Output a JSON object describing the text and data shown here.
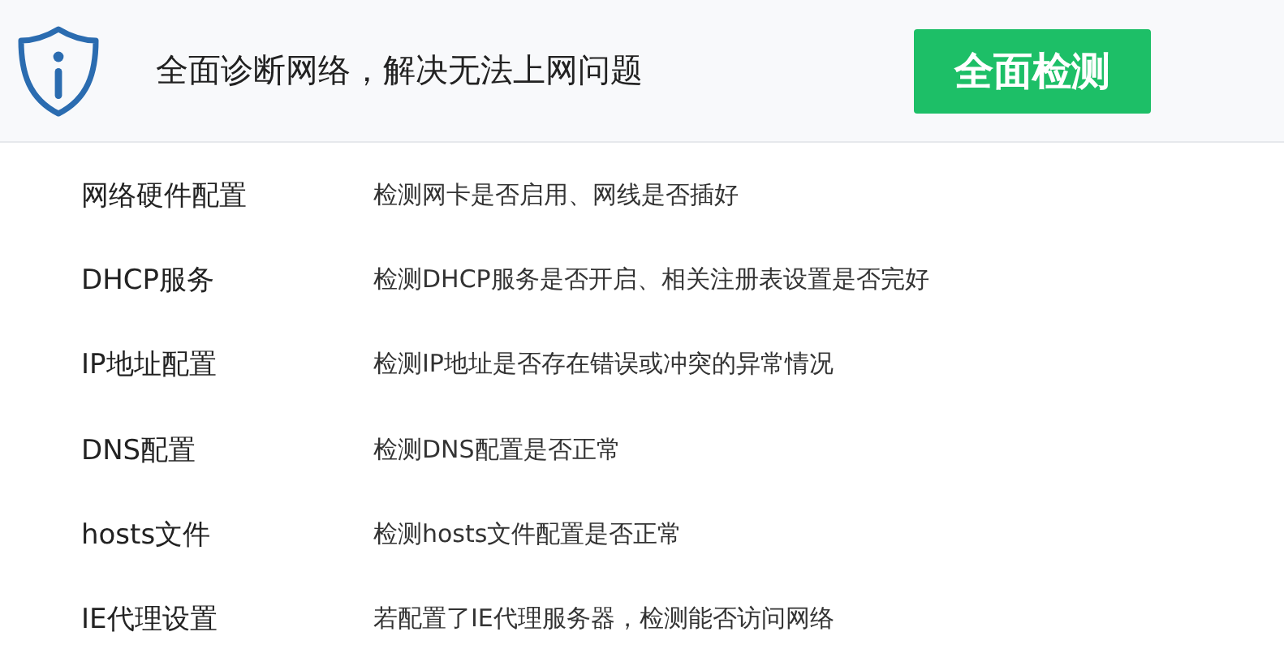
{
  "header": {
    "title": "全面诊断网络，解决无法上网问题",
    "button": "全面检测"
  },
  "items": [
    {
      "name": "网络硬件配置",
      "description": "检测网卡是否启用、网线是否插好"
    },
    {
      "name": "DHCP服务",
      "description": "检测DHCP服务是否开启、相关注册表设置是否完好"
    },
    {
      "name": "IP地址配置",
      "description": "检测IP地址是否存在错误或冲突的异常情况"
    },
    {
      "name": "DNS配置",
      "description": "检测DNS配置是否正常"
    },
    {
      "name": "hosts文件",
      "description": "检测hosts文件配置是否正常"
    },
    {
      "name": "IE代理设置",
      "description": "若配置了IE代理服务器，检测能否访问网络"
    }
  ]
}
